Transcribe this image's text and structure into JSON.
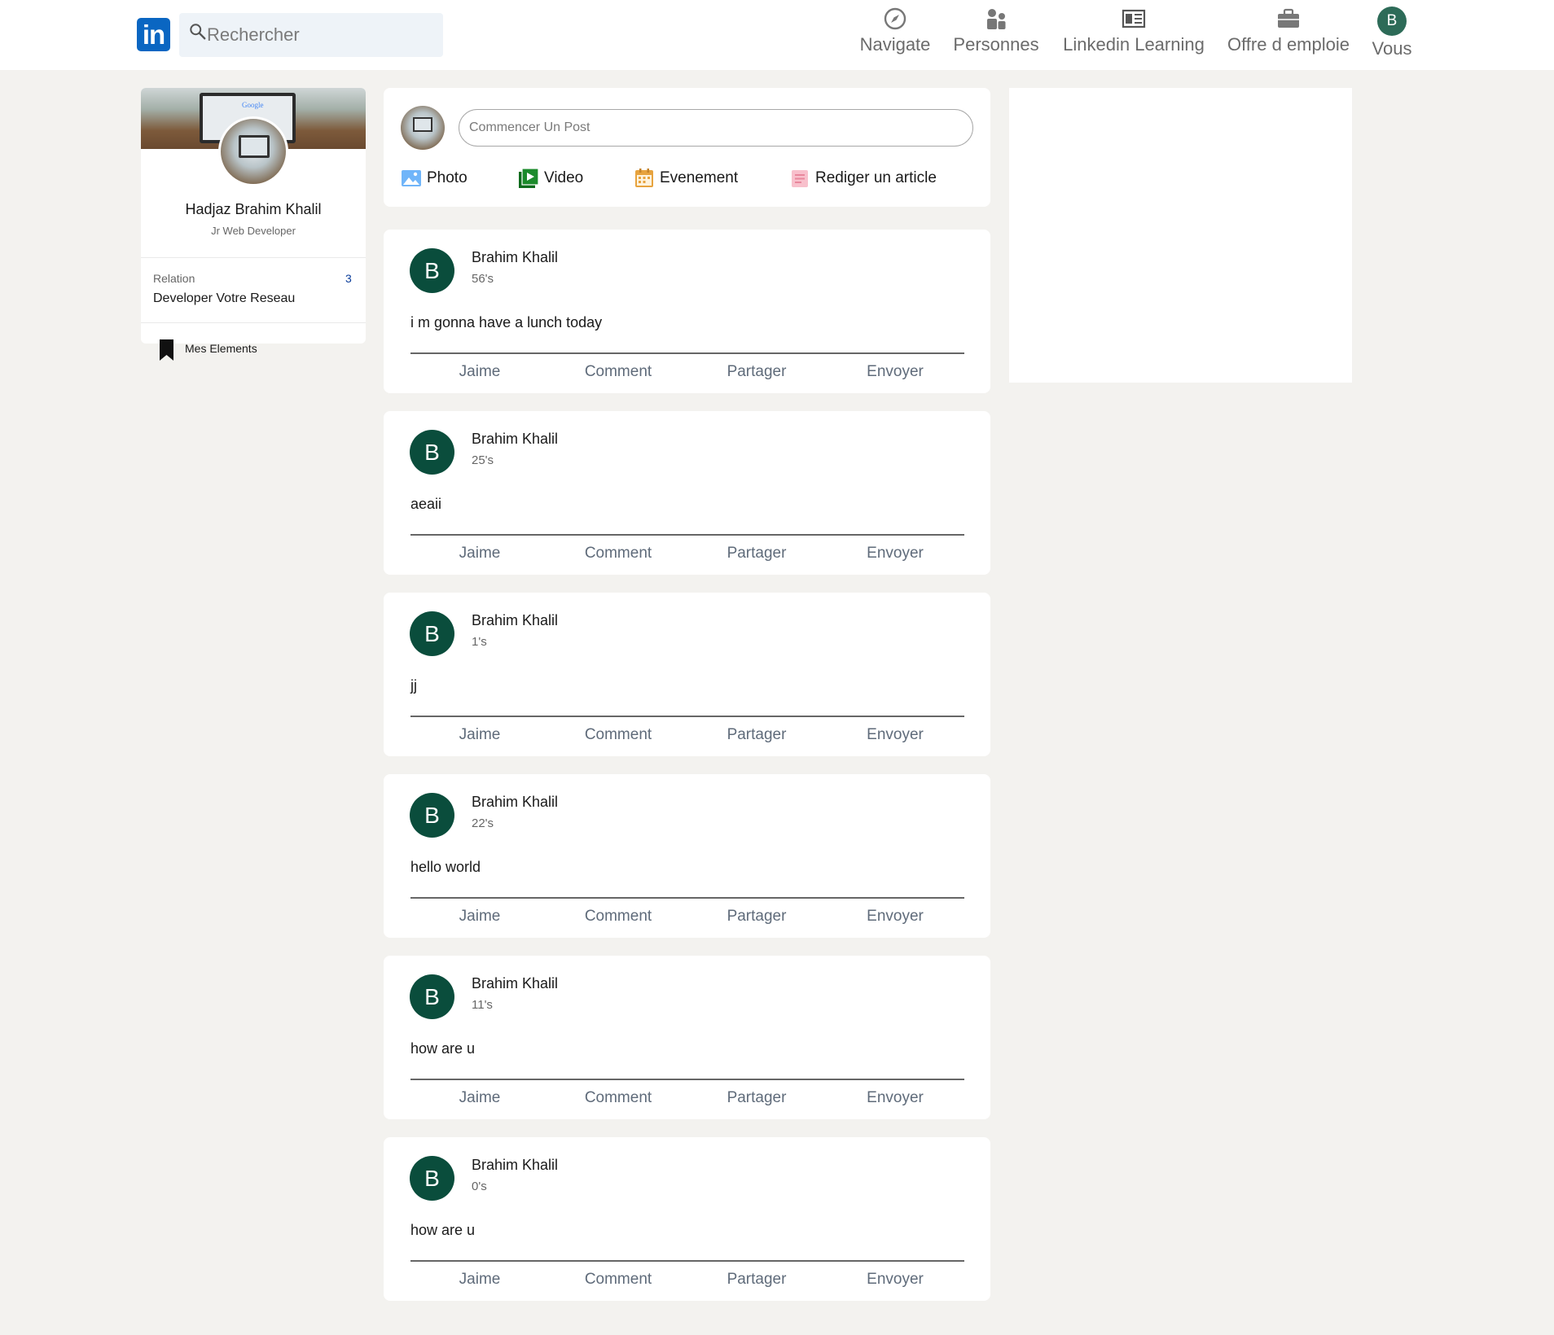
{
  "header": {
    "logo_text": "in",
    "search_placeholder": "Rechercher",
    "nav": [
      {
        "label": "Navigate",
        "icon": "compass-icon"
      },
      {
        "label": "Personnes",
        "icon": "people-icon"
      },
      {
        "label": "Linkedin Learning",
        "icon": "learning-icon"
      },
      {
        "label": "Offre d emploie",
        "icon": "briefcase-icon"
      },
      {
        "label": "Vous",
        "icon": "avatar",
        "avatar_letter": "B"
      }
    ]
  },
  "profile": {
    "name": "Hadjaz Brahim Khalil",
    "title": "Jr Web Developer",
    "banner_text": "Google",
    "relation_label": "Relation",
    "relation_count": "3",
    "relation_cta": "Developer Votre Reseau",
    "saved_label": "Mes Elements"
  },
  "composer": {
    "placeholder": "Commencer Un Post",
    "actions": [
      {
        "label": "Photo",
        "icon": "photo-icon",
        "color": "#70b5f9"
      },
      {
        "label": "Video",
        "icon": "video-icon",
        "color": "#1b8a2b"
      },
      {
        "label": "Evenement",
        "icon": "calendar-icon",
        "color": "#e7a33e"
      },
      {
        "label": "Rediger un article",
        "icon": "article-icon",
        "color": "#f5a3b5"
      }
    ]
  },
  "posts": [
    {
      "avatar": "B",
      "author": "Brahim Khalil",
      "time": "56's",
      "text": "i m gonna have a lunch today"
    },
    {
      "avatar": "B",
      "author": "Brahim Khalil",
      "time": "25's",
      "text": "aeaii"
    },
    {
      "avatar": "B",
      "author": "Brahim Khalil",
      "time": "1's",
      "text": "jj"
    },
    {
      "avatar": "B",
      "author": "Brahim Khalil",
      "time": "22's",
      "text": "hello world"
    },
    {
      "avatar": "B",
      "author": "Brahim Khalil",
      "time": "11's",
      "text": "how are u"
    },
    {
      "avatar": "B",
      "author": "Brahim Khalil",
      "time": "0's",
      "text": "how are u"
    }
  ],
  "post_actions": [
    "Jaime",
    "Comment",
    "Partager",
    "Envoyer"
  ],
  "colors": {
    "brand": "#0a66c2",
    "avatar_bg": "#0a4d3c",
    "page_bg": "#f3f2ef"
  }
}
